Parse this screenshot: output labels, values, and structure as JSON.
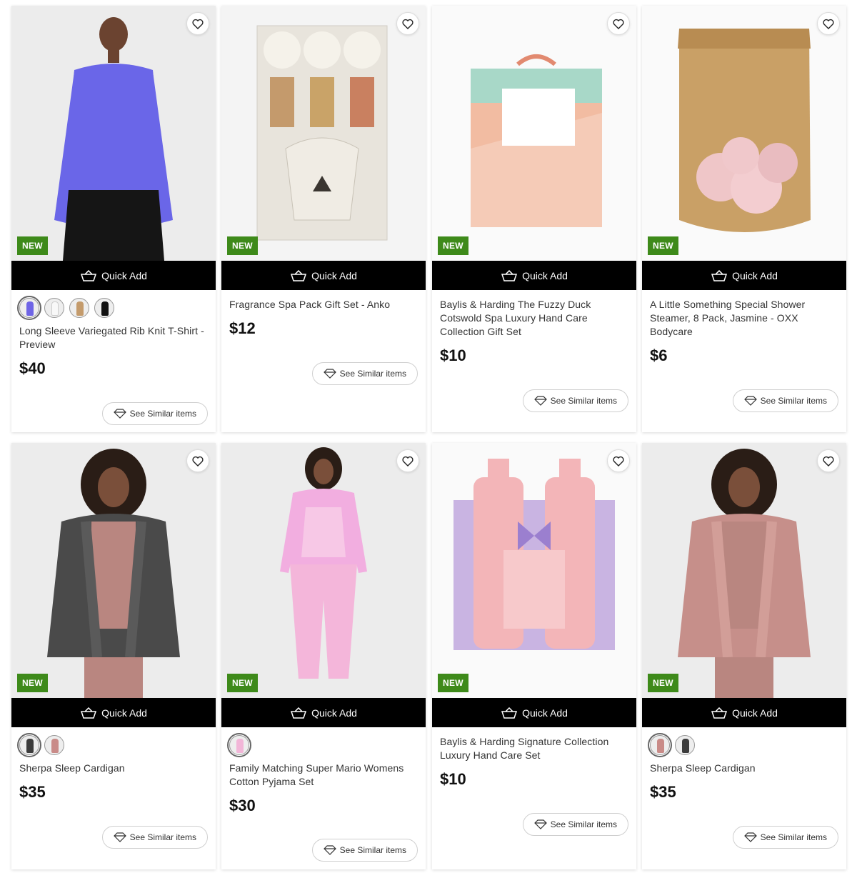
{
  "labels": {
    "quick_add": "Quick Add",
    "see_similar": "See Similar items",
    "new_badge": "NEW"
  },
  "products": [
    {
      "title": "Long Sleeve Variegated Rib Knit T-Shirt - Preview",
      "price": "$40",
      "swatches": [
        "#6f65e6",
        "#f2f2f2",
        "#c49b6c",
        "#111111"
      ],
      "image": "woman-purple-knit-top"
    },
    {
      "title": "Fragrance Spa Pack Gift Set - Anko",
      "price": "$12",
      "swatches": [],
      "image": "oil-burner-gift-set"
    },
    {
      "title": "Baylis & Harding The Fuzzy Duck Cotswold Spa Luxury Hand Care Collection Gift Set",
      "price": "$10",
      "swatches": [],
      "image": "fuzzy-duck-gift-box"
    },
    {
      "title": "A Little Something Special Shower Steamer, 8 Pack, Jasmine - OXX Bodycare",
      "price": "$6",
      "swatches": [],
      "image": "shower-steamer-pouch"
    },
    {
      "title": "Sherpa Sleep Cardigan",
      "price": "$35",
      "swatches": [
        "#3c3c3c",
        "#c98b88"
      ],
      "image": "woman-grey-sherpa-cardigan"
    },
    {
      "title": "Family Matching Super Mario Womens Cotton Pyjama Set",
      "price": "$30",
      "swatches": [
        "#f2b6d8"
      ],
      "image": "woman-pink-pyjamas"
    },
    {
      "title": "Baylis & Harding Signature Collection Luxury Hand Care Set",
      "price": "$10",
      "swatches": [],
      "image": "hand-care-set-bottles"
    },
    {
      "title": "Sherpa Sleep Cardigan",
      "price": "$35",
      "swatches": [
        "#c98b88",
        "#3c3c3c"
      ],
      "image": "woman-pink-sherpa-cardigan"
    }
  ],
  "colors": {
    "new_badge": "#3e8a1a",
    "quick_add_bg": "#000000"
  }
}
